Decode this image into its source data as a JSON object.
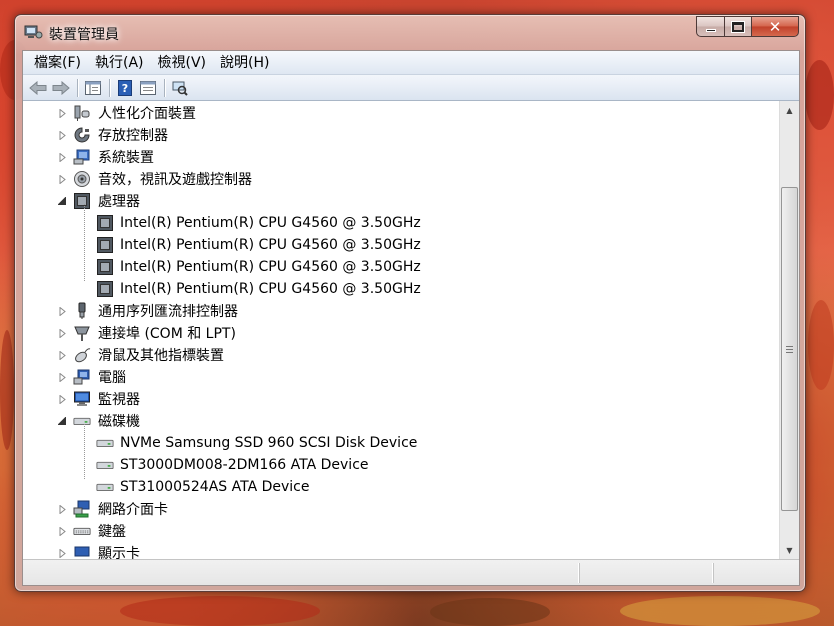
{
  "window": {
    "title": "裝置管理員",
    "close_glyph": "✕"
  },
  "menu": [
    "檔案(F)",
    "執行(A)",
    "檢視(V)",
    "說明(H)"
  ],
  "toolbar": {
    "buttons": [
      "back-arrow-icon",
      "forward-arrow-icon",
      "show-hide-console-tree-icon",
      "help-icon",
      "properties-icon",
      "scan-hardware-icon"
    ]
  },
  "tree": {
    "items": [
      {
        "label": "人性化介面裝置",
        "icon": "hid-icon",
        "expanded": false
      },
      {
        "label": "存放控制器",
        "icon": "storage-controller-icon",
        "expanded": false
      },
      {
        "label": "系統裝置",
        "icon": "system-devices-icon",
        "expanded": false
      },
      {
        "label": "音效，視訊及遊戲控制器",
        "icon": "sound-video-icon",
        "expanded": false
      },
      {
        "label": "處理器",
        "icon": "processor-icon",
        "expanded": true,
        "children": [
          "Intel(R) Pentium(R) CPU G4560 @ 3.50GHz",
          "Intel(R) Pentium(R) CPU G4560 @ 3.50GHz",
          "Intel(R) Pentium(R) CPU G4560 @ 3.50GHz",
          "Intel(R) Pentium(R) CPU G4560 @ 3.50GHz"
        ]
      },
      {
        "label": "通用序列匯流排控制器",
        "icon": "usb-icon",
        "expanded": false
      },
      {
        "label": "連接埠 (COM 和 LPT)",
        "icon": "port-icon",
        "expanded": false
      },
      {
        "label": "滑鼠及其他指標裝置",
        "icon": "mouse-icon",
        "expanded": false
      },
      {
        "label": "電腦",
        "icon": "computer-icon",
        "expanded": false
      },
      {
        "label": "監視器",
        "icon": "monitor-icon",
        "expanded": false
      },
      {
        "label": "磁碟機",
        "icon": "disk-drive-icon",
        "expanded": true,
        "children": [
          "NVMe Samsung SSD 960 SCSI Disk Device",
          "ST3000DM008-2DM166 ATA Device",
          "ST31000524AS ATA Device"
        ]
      },
      {
        "label": "網路介面卡",
        "icon": "network-adapter-icon",
        "expanded": false
      },
      {
        "label": "鍵盤",
        "icon": "keyboard-icon",
        "expanded": false
      },
      {
        "label": "顯示卡",
        "icon": "display-adapter-icon",
        "expanded": false
      }
    ]
  },
  "statusbar": {
    "text": ""
  }
}
